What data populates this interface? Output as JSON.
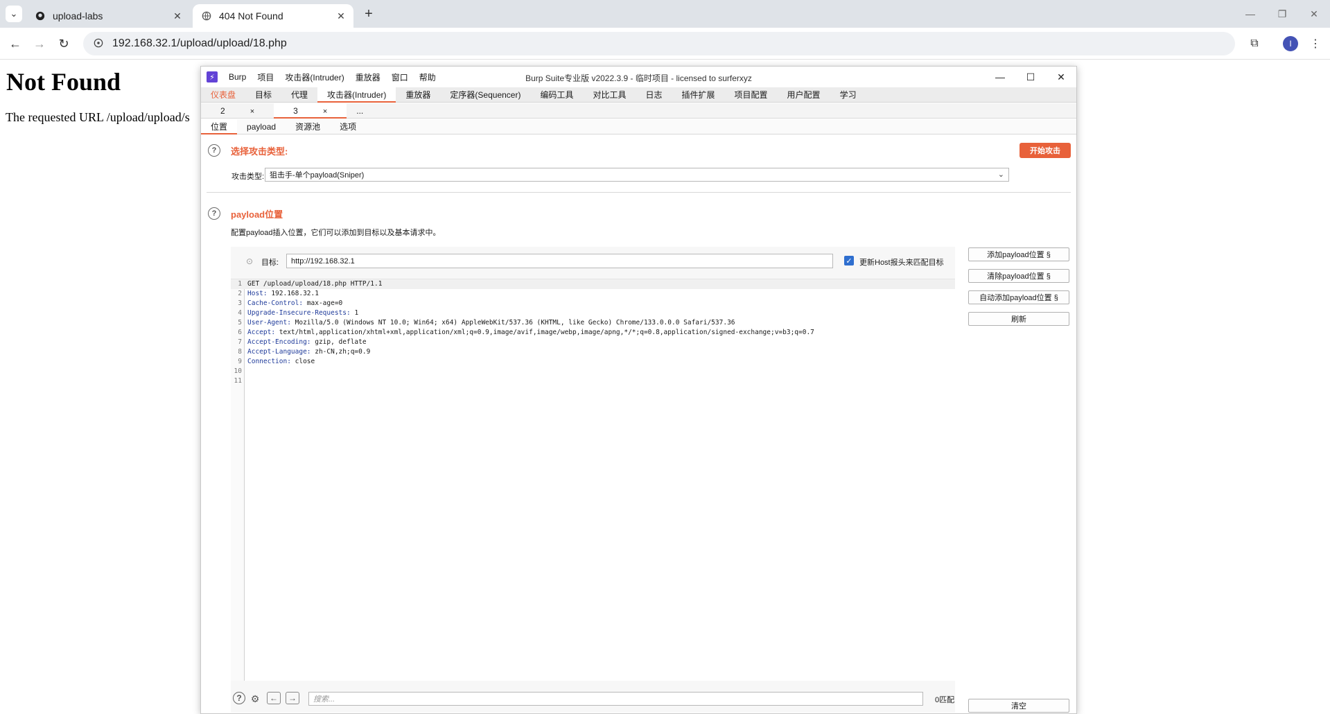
{
  "browser": {
    "tabs": [
      {
        "title": "upload-labs",
        "favicon": "github-icon",
        "active": false
      },
      {
        "title": "404 Not Found",
        "favicon": "globe-icon",
        "active": true
      }
    ],
    "url": "192.168.32.1/upload/upload/18.php",
    "profile_initial": "I"
  },
  "page": {
    "heading": "Not Found",
    "message": "The requested URL /upload/upload/s"
  },
  "burp": {
    "menu": [
      "Burp",
      "项目",
      "攻击器(Intruder)",
      "重放器",
      "窗口",
      "帮助"
    ],
    "title": "Burp Suite专业版  v2022.3.9 - 临时项目 - licensed to surferxyz",
    "main_tabs": [
      "仪表盘",
      "目标",
      "代理",
      "攻击器(Intruder)",
      "重放器",
      "定序器(Sequencer)",
      "编码工具",
      "对比工具",
      "日志",
      "插件扩展",
      "项目配置",
      "用户配置",
      "学习"
    ],
    "sub_tabs": [
      {
        "label": "2",
        "close": "×"
      },
      {
        "label": "3",
        "close": "×"
      },
      {
        "label": "..."
      }
    ],
    "section_tabs": [
      "位置",
      "payload",
      "资源池",
      "选项"
    ],
    "attack_type": {
      "title": "选择攻击类型:",
      "label": "攻击类型:",
      "value": "狙击手-单个payload(Sniper)",
      "start_button": "开始攻击"
    },
    "positions": {
      "title": "payload位置",
      "description": "配置payload插入位置，它们可以添加到目标以及基本请求中。",
      "target_label": "目标:",
      "target_value": "http://192.168.32.1",
      "host_checkbox_label": "更新Host报头来匹配目标",
      "host_checked": true
    },
    "request_lines": [
      {
        "n": "1",
        "header": "",
        "text": "GET /upload/upload/18.php HTTP/1.1"
      },
      {
        "n": "2",
        "header": "Host:",
        "text": " 192.168.32.1"
      },
      {
        "n": "3",
        "header": "Cache-Control:",
        "text": " max-age=0"
      },
      {
        "n": "4",
        "header": "Upgrade-Insecure-Requests:",
        "text": " 1"
      },
      {
        "n": "5",
        "header": "User-Agent:",
        "text": " Mozilla/5.0 (Windows NT 10.0; Win64; x64) AppleWebKit/537.36 (KHTML, like Gecko) Chrome/133.0.0.0 Safari/537.36"
      },
      {
        "n": "6",
        "header": "Accept:",
        "text": " text/html,application/xhtml+xml,application/xml;q=0.9,image/avif,image/webp,image/apng,*/*;q=0.8,application/signed-exchange;v=b3;q=0.7"
      },
      {
        "n": "7",
        "header": "Accept-Encoding:",
        "text": " gzip, deflate"
      },
      {
        "n": "8",
        "header": "Accept-Language:",
        "text": " zh-CN,zh;q=0.9"
      },
      {
        "n": "9",
        "header": "Connection:",
        "text": " close"
      },
      {
        "n": "10",
        "header": "",
        "text": ""
      },
      {
        "n": "11",
        "header": "",
        "text": ""
      }
    ],
    "side_buttons": [
      "添加payload位置 §",
      "清除payload位置 §",
      "自动添加payload位置 §",
      "刷新"
    ],
    "search_placeholder": "搜索...",
    "match_count": "0匹配",
    "clear_button": "清空",
    "accent_color": "#e8613a"
  }
}
